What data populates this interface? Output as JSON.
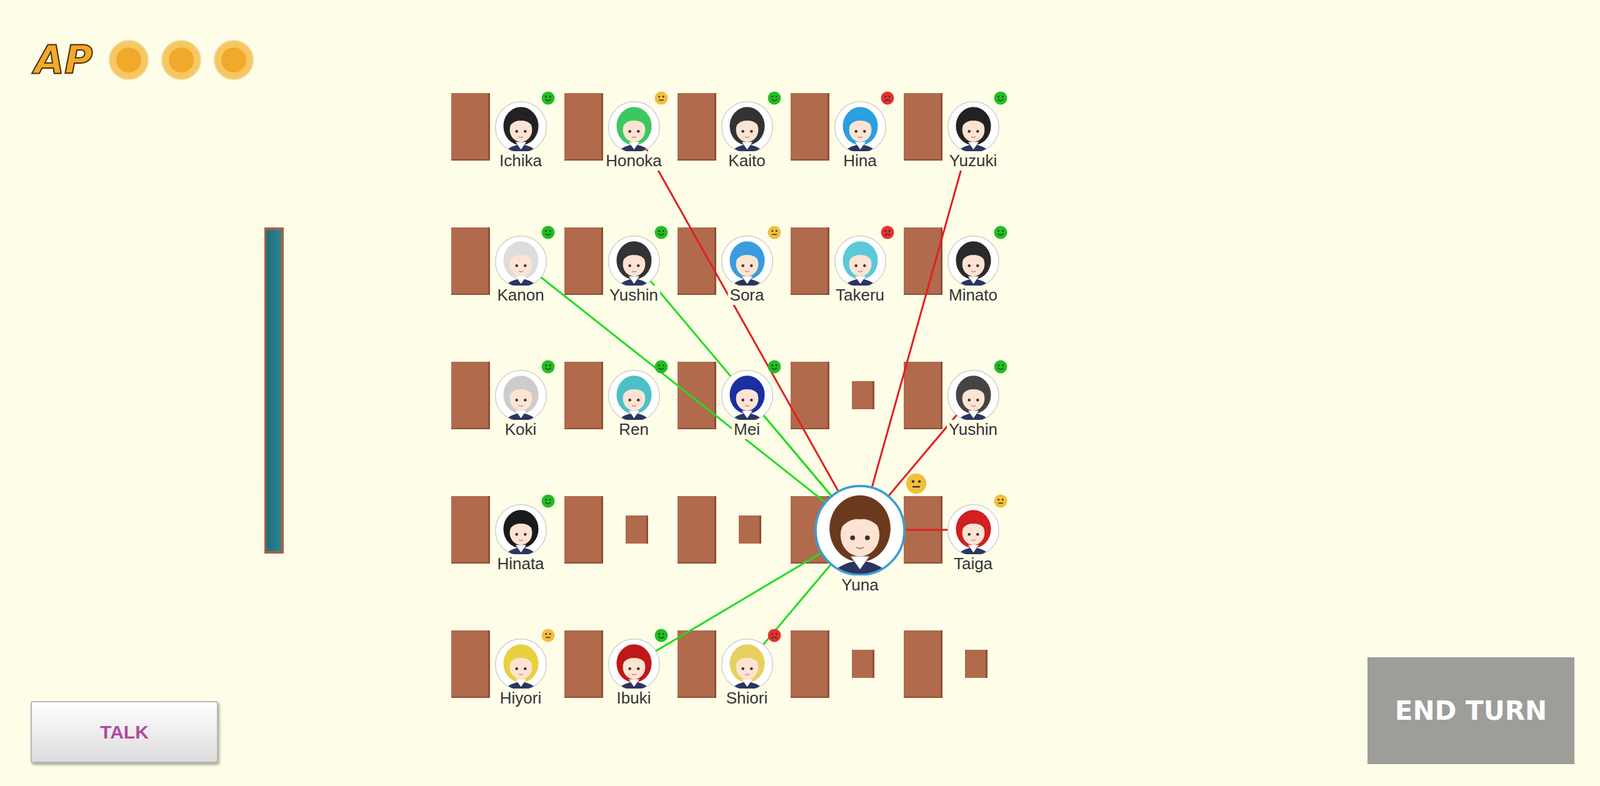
{
  "hud": {
    "ap_label": "AP",
    "ap_points": [
      {
        "filled": true
      },
      {
        "filled": true
      },
      {
        "filled": true
      }
    ]
  },
  "seats": [
    {
      "kind": "student",
      "name": "Ichika",
      "mood": "happy",
      "color": "#1fbf1f",
      "hair_color": "#222222",
      "linked": false,
      "link_color": ""
    },
    {
      "kind": "student",
      "name": "Honoka",
      "mood": "neutral",
      "color": "#f2bf3a",
      "hair_color": "#3cc860",
      "linked": true,
      "link_color": "#e02020"
    },
    {
      "kind": "student",
      "name": "Kaito",
      "mood": "happy",
      "color": "#1fbf1f",
      "hair_color": "#333333",
      "linked": false,
      "link_color": ""
    },
    {
      "kind": "student",
      "name": "Hina",
      "mood": "upset",
      "color": "#e53030",
      "hair_color": "#2aa0e0",
      "linked": false,
      "link_color": ""
    },
    {
      "kind": "student",
      "name": "Yuzuki",
      "mood": "happy",
      "color": "#1fbf1f",
      "hair_color": "#222222",
      "linked": true,
      "link_color": "#e02020"
    },
    {
      "kind": "student",
      "name": "Kanon",
      "mood": "happy",
      "color": "#1fbf1f",
      "hair_color": "#dddddd",
      "linked": true,
      "link_color": "#22dd22"
    },
    {
      "kind": "student",
      "name": "Yushin",
      "mood": "happy",
      "color": "#1fbf1f",
      "hair_color": "#333333",
      "linked": true,
      "link_color": "#22dd22"
    },
    {
      "kind": "student",
      "name": "Sora",
      "mood": "neutral",
      "color": "#f2bf3a",
      "hair_color": "#3a9be0",
      "linked": false,
      "link_color": ""
    },
    {
      "kind": "student",
      "name": "Takeru",
      "mood": "upset",
      "color": "#e53030",
      "hair_color": "#5cc8d8",
      "linked": false,
      "link_color": ""
    },
    {
      "kind": "student",
      "name": "Minato",
      "mood": "happy",
      "color": "#1fbf1f",
      "hair_color": "#2a2a2a",
      "linked": false,
      "link_color": ""
    },
    {
      "kind": "student",
      "name": "Koki",
      "mood": "happy",
      "color": "#1fbf1f",
      "hair_color": "#cccccc",
      "linked": false,
      "link_color": ""
    },
    {
      "kind": "student",
      "name": "Ren",
      "mood": "happy",
      "color": "#1fbf1f",
      "hair_color": "#4cc0c8",
      "linked": false,
      "link_color": ""
    },
    {
      "kind": "student",
      "name": "Mei",
      "mood": "happy",
      "color": "#1fbf1f",
      "hair_color": "#1a2fa0",
      "linked": true,
      "link_color": "#22dd22"
    },
    {
      "kind": "empty"
    },
    {
      "kind": "student",
      "name": "Yushin",
      "mood": "happy",
      "color": "#1fbf1f",
      "hair_color": "#444444",
      "linked": true,
      "link_color": "#e02020"
    },
    {
      "kind": "student",
      "name": "Hinata",
      "mood": "happy",
      "color": "#1fbf1f",
      "hair_color": "#1a1a1a",
      "linked": false,
      "link_color": ""
    },
    {
      "kind": "empty"
    },
    {
      "kind": "empty"
    },
    {
      "kind": "player",
      "name": "Yuna",
      "mood": "neutral",
      "color": "#f2bf3a",
      "hair_color": "#6b3a1e",
      "linked": false,
      "link_color": ""
    },
    {
      "kind": "student",
      "name": "Taiga",
      "mood": "neutral",
      "color": "#f2bf3a",
      "hair_color": "#d02020",
      "linked": true,
      "link_color": "#e02020"
    },
    {
      "kind": "student",
      "name": "Hiyori",
      "mood": "neutral",
      "color": "#f2bf3a",
      "hair_color": "#e8d040",
      "linked": false,
      "link_color": ""
    },
    {
      "kind": "student",
      "name": "Ibuki",
      "mood": "happy",
      "color": "#1fbf1f",
      "hair_color": "#c01818",
      "linked": true,
      "link_color": "#22dd22"
    },
    {
      "kind": "student",
      "name": "Shiori",
      "mood": "upset",
      "color": "#e53030",
      "hair_color": "#e8d060",
      "linked": true,
      "link_color": "#22dd22"
    },
    {
      "kind": "empty"
    },
    {
      "kind": "empty"
    }
  ],
  "buttons": {
    "talk": "TALK",
    "end_turn": "END TURN"
  }
}
